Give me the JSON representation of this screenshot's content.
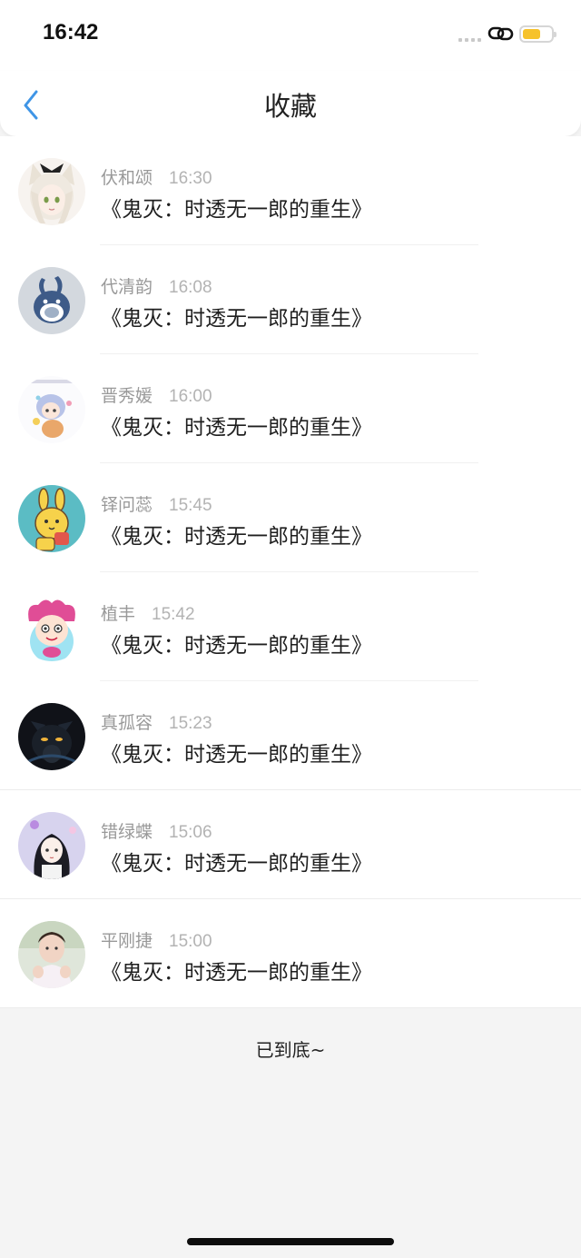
{
  "status_bar": {
    "time": "16:42",
    "battery_color": "#f6c22b"
  },
  "nav": {
    "title": "收藏",
    "back_icon": "chevron-left-icon",
    "accent": "#3f95e6"
  },
  "favorites": [
    {
      "name": "伏和颂",
      "time": "16:30",
      "title": "《鬼灭：时透无一郎的重生》",
      "avatar": "anime-catgirl-avatar"
    },
    {
      "name": "代清韵",
      "time": "16:08",
      "title": "《鬼灭：时透无一郎的重生》",
      "avatar": "blue-rabbit-avatar"
    },
    {
      "name": "晋秀媛",
      "time": "16:00",
      "title": "《鬼灭：时透无一郎的重生》",
      "avatar": "chibi-anime-avatar"
    },
    {
      "name": "铎问蕊",
      "time": "15:45",
      "title": "《鬼灭：时透无一郎的重生》",
      "avatar": "yellow-bunny-avatar"
    },
    {
      "name": "植丰",
      "time": "15:42",
      "title": "《鬼灭：时透无一郎的重生》",
      "avatar": "pink-hat-cartoon-avatar"
    },
    {
      "name": "真孤容",
      "time": "15:23",
      "title": "《鬼灭：时透无一郎的重生》",
      "avatar": "dark-wolf-avatar"
    },
    {
      "name": "错绿蝶",
      "time": "15:06",
      "title": "《鬼灭：时透无一郎的重生》",
      "avatar": "anime-girl-avatar"
    },
    {
      "name": "平刚捷",
      "time": "15:00",
      "title": "《鬼灭：时透无一郎的重生》",
      "avatar": "photo-portrait-avatar"
    }
  ],
  "footer": {
    "end_text": "已到底~"
  }
}
